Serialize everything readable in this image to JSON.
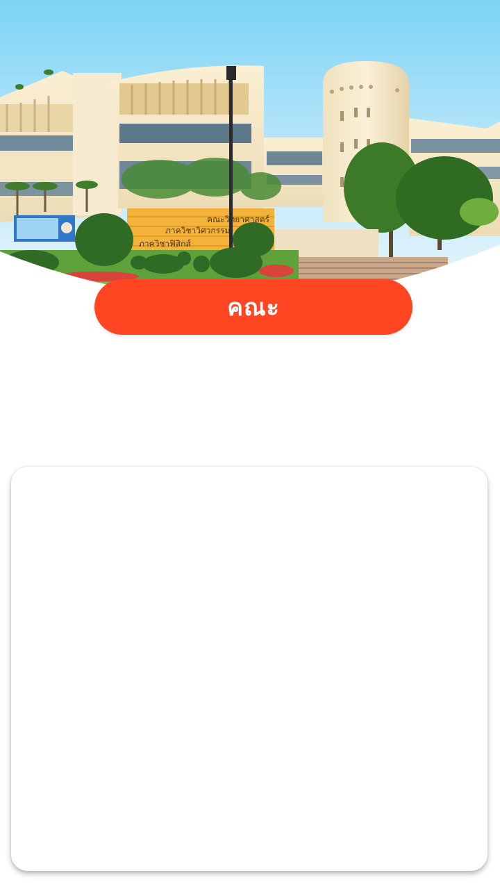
{
  "header": {
    "title": "คณะ",
    "accent_color": "#ff4522"
  },
  "hero": {
    "image": "faculty-building-photo",
    "sign_lines": [
      "คณะวิทยาศาสตร์",
      "ภาควิชาวิศวกรรม",
      "ภาควิชาฟิสิกส์"
    ]
  },
  "content_card": {
    "background": "#ffffff"
  }
}
